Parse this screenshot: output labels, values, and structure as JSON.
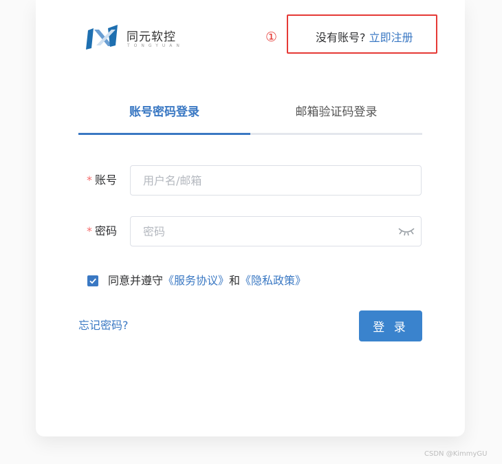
{
  "brand": {
    "name": "同元软控",
    "subtitle": "TONGYUAN"
  },
  "annotation": {
    "number": "①"
  },
  "register": {
    "prompt": "没有账号?",
    "link": "立即注册"
  },
  "tabs": [
    {
      "label": "账号密码登录",
      "active": true
    },
    {
      "label": "邮箱验证码登录",
      "active": false
    }
  ],
  "form": {
    "account": {
      "required_mark": "*",
      "label": "账号",
      "placeholder": "用户名/邮箱",
      "value": ""
    },
    "password": {
      "required_mark": "*",
      "label": "密码",
      "placeholder": "密码",
      "value": ""
    }
  },
  "agreement": {
    "checked": true,
    "prefix": "同意并遵守",
    "service": "《服务协议》",
    "joiner": "和",
    "privacy": "《隐私政策》"
  },
  "forgot": "忘记密码?",
  "login_button": "登 录",
  "watermark": "CSDN @KimmyGU",
  "colors": {
    "accent": "#3a78c3",
    "annotation": "#e53935",
    "required": "#f56c6c"
  }
}
